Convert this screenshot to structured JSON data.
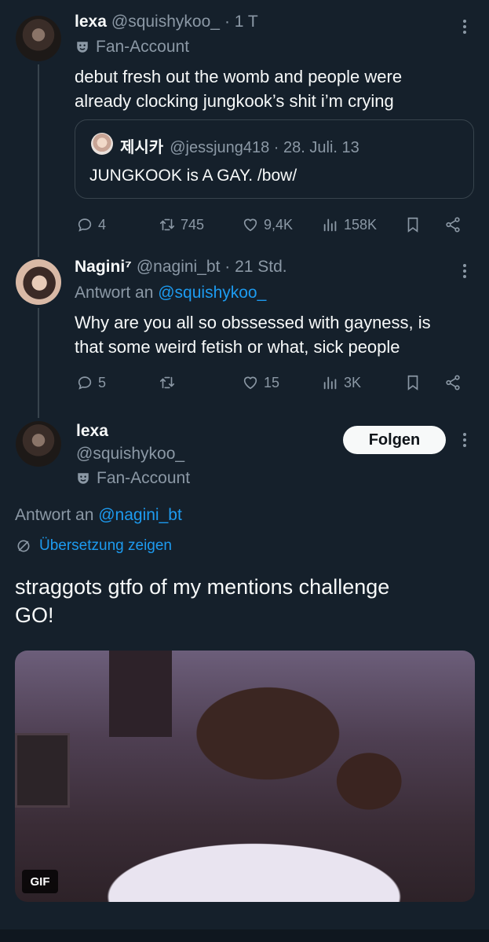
{
  "tweet1": {
    "name": "lexa",
    "handle": "@squishykoo_",
    "time": "· 1 T",
    "badge": "Fan-Account",
    "text_line1": "debut fresh out the womb and people were",
    "text_line2": "already clocking jungkook’s shit i’m crying",
    "quote": {
      "name": "제시카",
      "handle": "@jessjung418 · 28. Juli. 13",
      "text": "JUNGKOOK is A GAY. /bow/"
    },
    "actions": {
      "replies": "4",
      "retweets": "745",
      "likes": "9,4K",
      "views": "158K"
    }
  },
  "tweet2": {
    "name": "Nagini⁷",
    "handle": "@nagini_bt · 21 Std.",
    "reply_prefix": "Antwort an",
    "reply_to": "@squishykoo_",
    "text_line1": "Why are you all so obssessed with gayness, is",
    "text_line2": "that some weird fetish or what, sick people",
    "actions": {
      "replies": "5",
      "retweets": "",
      "likes": "15",
      "views": "3K"
    }
  },
  "tweet3": {
    "name": "lexa",
    "handle": "@squishykoo_",
    "badge": "Fan-Account",
    "follow_label": "Folgen",
    "reply_prefix": "Antwort an",
    "reply_to": "@nagini_bt",
    "translate_label": "Übersetzung zeigen",
    "text_line1": "straggots gtfo of my mentions challenge",
    "text_line2": "GO!",
    "gif_label": "GIF"
  },
  "colors": {
    "background": "#15202b",
    "text": "#f7f9f9",
    "muted": "#8b98a5",
    "link": "#1d9bf0",
    "border": "#38444d"
  }
}
